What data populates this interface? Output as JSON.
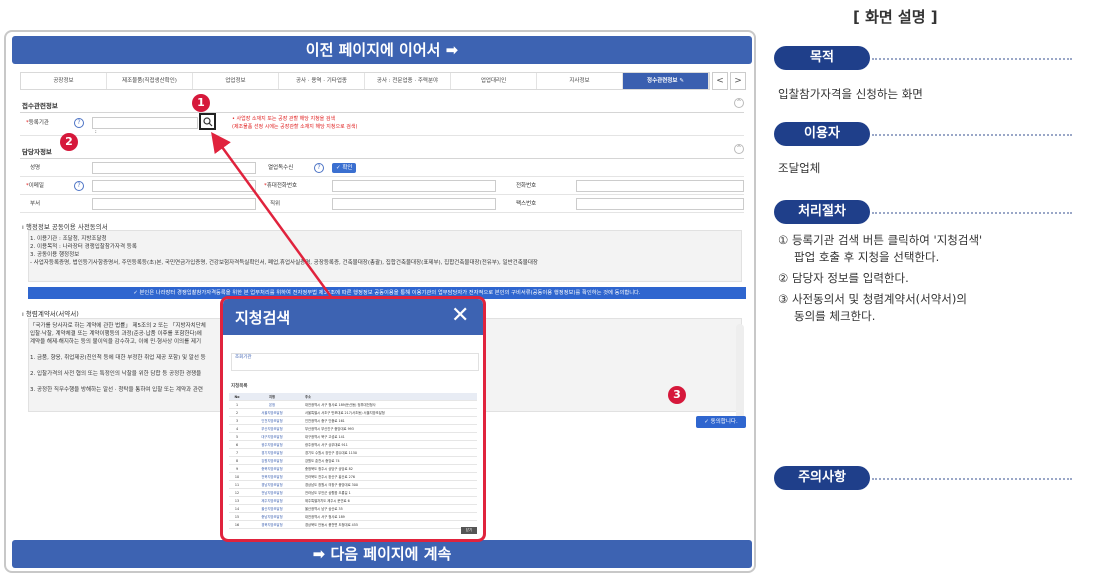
{
  "top_banner": "이전 페이지에 이어서 ➡",
  "bottom_banner": "➡ 다음 페이지에 계속",
  "tabs": [
    "공장정보",
    "제조물품(직접생산확인)",
    "업업정보",
    "공사 · 용역 · 기타업종",
    "공사 : 전문업종 · 주력분야",
    "업업대리인",
    "지사정보",
    "정수관련정보 ✎"
  ],
  "tab_nav": {
    "prev": "<",
    "next": ">"
  },
  "section1": {
    "title": "접수관련정보",
    "field_label": "등록기관",
    "field_value": ":",
    "notice_line1": "• 사업장 소재지 또는 공장 관할 해당 지청을 검색",
    "notice_line2": "(제조물품 선정 시에는 공장관할 소재지 해당 지청으로 검색)"
  },
  "section2": {
    "title": "담당자정보",
    "rows": [
      {
        "l1": "성명",
        "l2": "열업독수신",
        "l3": "",
        "chk": "✓ 확인"
      },
      {
        "l1": "이메일",
        "l2": "휴대전화번호",
        "l3": "전화번호"
      },
      {
        "l1": "부서",
        "l2": "직위",
        "l3": "팩스번호"
      }
    ]
  },
  "consent": {
    "title": "행정정보 공동이용 사전동의서",
    "lines": [
      "1. 이용기관 : 조달청, 지방조달청",
      "2. 이용목적 : 나라장터 경쟁입찰참가자격 등록",
      "3. 공동이용 행정정보",
      "  - 사업자등록증명, 법인등기사항증명서, 주민등록등(초)본, 국민연금가입증명, 건강보험자격득실확인서, 폐업,휴업사실증명, 공장등록증, 건축물대장(총괄), 집합건축물대장(표제부), 집합건축물대장(전유부), 일반건축물대장"
    ],
    "bar": "✓ 본인은 나라장터 경쟁입찰참가자격등록을 위한 본 업무처리를 위하여 전자정부법 제36조에 따른 행정정보 공동이용을 통해 이용기관의 업무담당자가 전자적으로 본인의 구비서류(공동이용 행정정보)를 확인하는 것에 동의합니다."
  },
  "pledge": {
    "title": "청렴계약서(서약서)",
    "lines": [
      "「국가를 당사자로 하는 계약에 관한 법률」 제5조의 2 또는 「지방자치단체",
      "입찰·낙찰, 계약체결 또는 계약이행등의 과정(준공·납품 이후를 포함한다)에",
      "계약을 해제·해지하는 등의 불이익을 감수하고, 이에 민·형사상 이의를 제기",
      "1. 금품, 향응, 취업제공(친인척 등에 대한 부정한 취업 제공 포함) 및 알선 등",
      "2. 입찰가격의 사전 협의 또는 특정인의 낙찰을 위한 담합 등 공정한 경쟁을",
      "3. 공정한 직무수행을 방해하는 알선 · 청탁을 통하여 입찰 또는 계약과 관련"
    ],
    "agree": "✓ 동의합니다."
  },
  "popup": {
    "title": "지청검색",
    "close": "✕",
    "subinfo": "조회기관",
    "count_label": "지청목록",
    "headers": [
      "No",
      "지청",
      "주소"
    ],
    "rows": [
      [
        "1",
        "본청",
        "대전광역시 서구 청사로 189(둔산동) 정부대전청사"
      ],
      [
        "2",
        "서울지방조달청",
        "서울특별시 서초구 반포대로 217(서초동) 서울지방조달청"
      ],
      [
        "3",
        "인천지방조달청",
        "인천광역시 중구 인중로 161"
      ],
      [
        "4",
        "부산지방조달청",
        "부산광역시 부산진구 중앙대로 993"
      ],
      [
        "5",
        "대구지방조달청",
        "대구광역시 북구 고성로 141"
      ],
      [
        "6",
        "광주지방조달청",
        "광주광역시 서구 상무대로 911"
      ],
      [
        "7",
        "경기지방조달청",
        "경기도 수원시 장안구 경수대로 1150"
      ],
      [
        "8",
        "강원지방조달청",
        "강원도 춘천시 중앙로 74"
      ],
      [
        "9",
        "충북지방조달청",
        "충청북도 청주시 상당구 상당로 82"
      ],
      [
        "10",
        "전북지방조달청",
        "전라북도 전주시 완산구 홍산로 276"
      ],
      [
        "11",
        "경남지방조달청",
        "경상남도 창원시 의창구 중앙대로 300"
      ],
      [
        "12",
        "전남지방조달청",
        "전라남도 무안군 삼향읍 오룡길 1"
      ],
      [
        "13",
        "제주지방조달청",
        "제주특별자치도 제주시 문연로 6"
      ],
      [
        "14",
        "울산지방조달청",
        "울산광역시 남구 삼산로 35"
      ],
      [
        "15",
        "충남지방조달청",
        "대전광역시 서구 청사로 189"
      ],
      [
        "16",
        "경북지방조달청",
        "경상북도 안동시 풍천면 도청대로 455"
      ]
    ],
    "btn": "닫기"
  },
  "markers": {
    "m1": "1",
    "m2": "2",
    "m3": "3"
  },
  "right_panel": {
    "title": "[ 화면 설명 ]",
    "purpose_label": "목적",
    "purpose_text": "입찰참가자격을 신청하는 화면",
    "user_label": "이용자",
    "user_text": "조달업체",
    "process_label": "처리절차",
    "step1a": "① 등록기관 검색 버튼 클릭하여 '지청검색'",
    "step1b": "팝업 호출 후 지청을 선택한다.",
    "step2": "② 담당자 정보를 입력한다.",
    "step3a": "③ 사전동의서 및 청렴계약서(서약서)의",
    "step3b": "동의를 체크한다.",
    "caution_label": "주의사항"
  }
}
